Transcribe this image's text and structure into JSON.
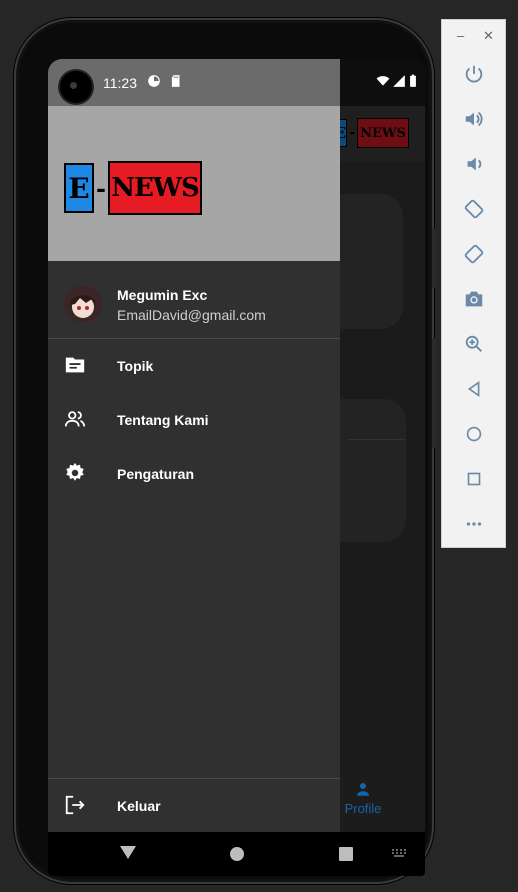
{
  "status_bar": {
    "time": "11:23"
  },
  "drawer": {
    "logo": {
      "e": "E",
      "dash": "-",
      "news": "NEWS"
    },
    "user": {
      "name": "Megumin Exc",
      "email": "EmailDavid@gmail.com"
    },
    "menu": [
      {
        "label": "Topik",
        "icon": "topic-icon"
      },
      {
        "label": "Tentang Kami",
        "icon": "people-icon"
      },
      {
        "label": "Pengaturan",
        "icon": "gear-icon"
      }
    ],
    "logout_label": "Keluar"
  },
  "background_app": {
    "logo": {
      "e": "E",
      "dash": "-",
      "news": "NEWS"
    },
    "bottom_nav_label": "Profile"
  },
  "colors": {
    "accent_blue": "#1e88e5",
    "accent_red": "#e61b24",
    "drawer_bg": "#303030",
    "header_bg": "#a6a6a6"
  }
}
